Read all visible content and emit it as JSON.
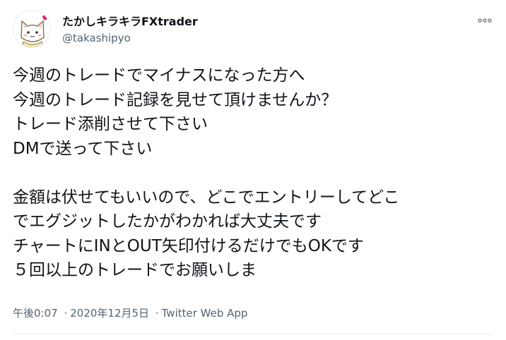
{
  "user": {
    "display_name": "たかしキラキラFXtrader",
    "handle": "@takashipyo"
  },
  "icons": {
    "avatar": "cat-avatar-icon",
    "more": "more-horizontal-icon"
  },
  "tweet": {
    "lines": [
      "今週のトレードでマイナスになった方へ",
      "今週のトレード記録を見せて頂けませんか？",
      "トレード添削させて下さい",
      "DMで送って下さい",
      "",
      "金額は伏せてもいいので、どこでエントリーしてどこ",
      "でエグジットしたかがわかれば大丈夫です",
      "チャートにINとOUT矢印付けるだけでもOKです",
      "５回以上のトレードでお願いしま"
    ]
  },
  "meta": {
    "time": "午後0:07",
    "date": "2020年12月5日",
    "separator": "·",
    "source": "Twitter Web App"
  },
  "colors": {
    "text": "#0f1419",
    "secondary": "#536471",
    "divider": "#e6ecf0",
    "heart": "#e0245e"
  }
}
